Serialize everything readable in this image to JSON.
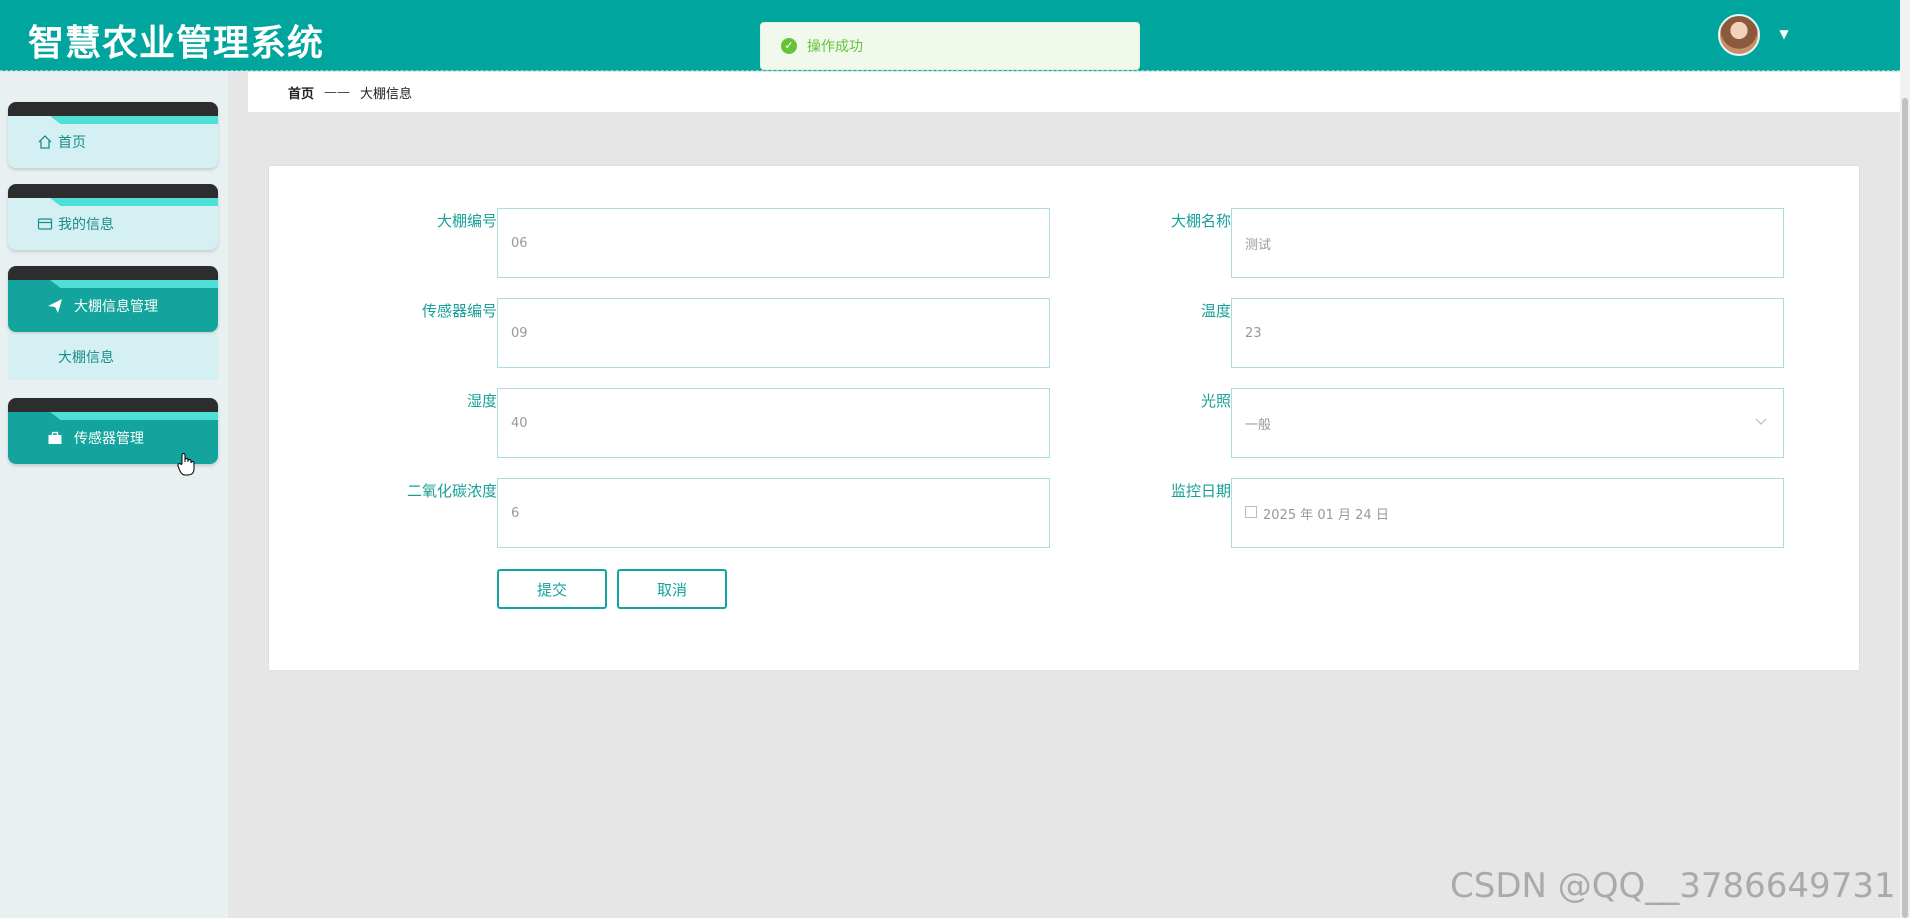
{
  "header": {
    "app_title": "智慧农业管理系统",
    "user_menu_caret": "▼"
  },
  "toast": {
    "message": "操作成功",
    "type_color": "#67c23a"
  },
  "sidebar": {
    "items": [
      {
        "label": "首页",
        "icon": "home-icon",
        "active": false
      },
      {
        "label": "我的信息",
        "icon": "id-card-icon",
        "active": false
      },
      {
        "label": "大棚信息管理",
        "icon": "paper-plane-icon",
        "active": true
      },
      {
        "label": "传感器管理",
        "icon": "briefcase-icon",
        "active": true
      }
    ],
    "submenu": [
      {
        "label": "大棚信息"
      }
    ]
  },
  "breadcrumb": {
    "home": "首页",
    "separator": "——",
    "current": "大棚信息"
  },
  "form": {
    "fields": [
      {
        "label": "大棚编号",
        "value": "06"
      },
      {
        "label": "大棚名称",
        "value": "测试"
      },
      {
        "label": "传感器编号",
        "value": "09"
      },
      {
        "label": "温度",
        "value": "23"
      },
      {
        "label": "湿度",
        "value": "40"
      },
      {
        "label": "光照",
        "value": "一般",
        "type": "select"
      },
      {
        "label": "二氧化碳浓度",
        "value": "6"
      },
      {
        "label": "监控日期",
        "value": "2025 年 01 月 24 日",
        "type": "date"
      }
    ],
    "submit_label": "提交",
    "cancel_label": "取消"
  },
  "watermark": "CSDN @QQ__3786649731",
  "colors": {
    "primary": "#00a69d",
    "accent": "#12a49d",
    "sidebar_bg": "#e8f0f2"
  }
}
